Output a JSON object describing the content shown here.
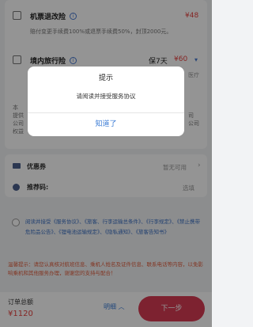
{
  "insurance": {
    "refund": {
      "title": "机票退改险",
      "price": "¥48",
      "desc": "赔付变更手续费100%或退票手续费50%，封顶2000元。"
    },
    "travel": {
      "title": "境内旅行险",
      "duration": "保7天",
      "price": "¥60",
      "desc_right": "医疗",
      "desc_left_lines": [
        "本",
        "提供",
        "公司",
        "权益"
      ],
      "desc_right_lines": [
        "司",
        "公司"
      ]
    }
  },
  "modal": {
    "title": "提示",
    "message": "请阅读并接受服务协议",
    "button": "知道了"
  },
  "coupon": {
    "label": "优惠券",
    "value": "暂无可用"
  },
  "referral": {
    "label": "推荐码:",
    "value": "选填"
  },
  "agreement": {
    "text": "阅读并接受《服务协议》、《旅客、行李运输总条件》、《行李规定》、《禁止携带危险品公告》、《锂电池运输规定》、《隐私通知》、《旅客告知书》"
  },
  "notice": {
    "text": "温馨提示：请您认真核对航班信息、乘机人姓名及证件信息、联系电话等内容，以免影响乘机和其他服务办理，谢谢您的支持与配合！"
  },
  "footer": {
    "total_label": "订单总额",
    "total_price": "¥1120",
    "detail_label": "明细",
    "next_label": "下一步"
  },
  "colors": {
    "accent": "#d83b54",
    "price": "#e64340",
    "link": "#3a7bd5"
  }
}
